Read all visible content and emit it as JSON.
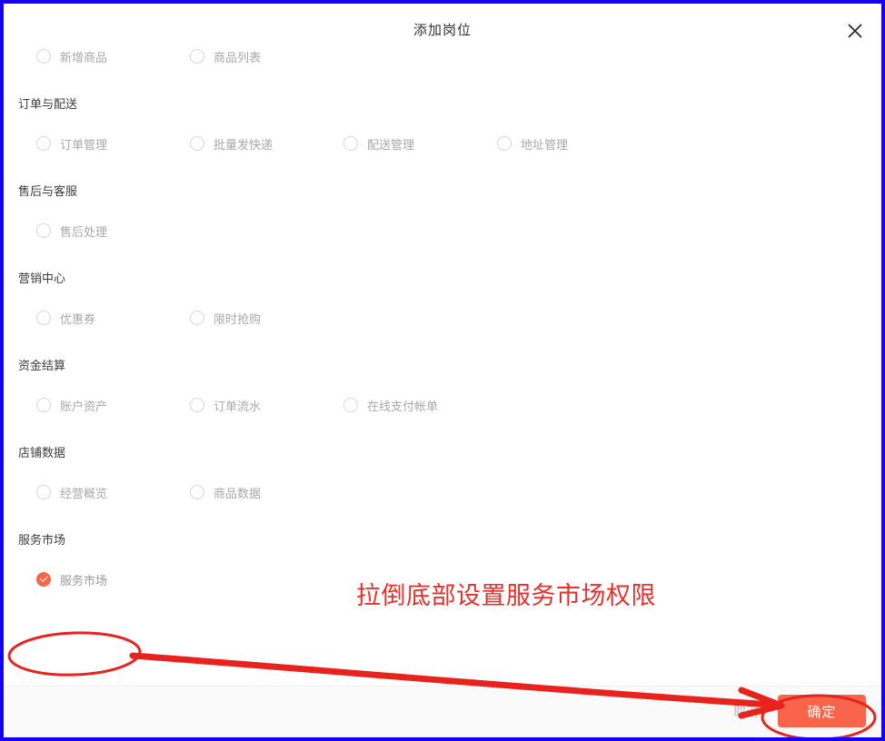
{
  "dialog": {
    "title": "添加岗位",
    "close_icon": "close-icon"
  },
  "groups": [
    {
      "title": "",
      "items": [
        {
          "label": "新增商品",
          "checked": false
        },
        {
          "label": "商品列表",
          "checked": false
        }
      ]
    },
    {
      "title": "订单与配送",
      "items": [
        {
          "label": "订单管理",
          "checked": false
        },
        {
          "label": "批量发快递",
          "checked": false
        },
        {
          "label": "配送管理",
          "checked": false
        },
        {
          "label": "地址管理",
          "checked": false
        }
      ]
    },
    {
      "title": "售后与客服",
      "items": [
        {
          "label": "售后处理",
          "checked": false
        }
      ]
    },
    {
      "title": "营销中心",
      "items": [
        {
          "label": "优惠券",
          "checked": false
        },
        {
          "label": "限时抢购",
          "checked": false
        }
      ]
    },
    {
      "title": "资金结算",
      "items": [
        {
          "label": "账户资产",
          "checked": false
        },
        {
          "label": "订单流水",
          "checked": false
        },
        {
          "label": "在线支付帐单",
          "checked": false
        }
      ]
    },
    {
      "title": "店铺数据",
      "items": [
        {
          "label": "经营概览",
          "checked": false
        },
        {
          "label": "商品数据",
          "checked": false
        }
      ]
    },
    {
      "title": "服务市场",
      "items": [
        {
          "label": "服务市场",
          "checked": true
        }
      ]
    }
  ],
  "footer": {
    "cancel_label": "取消",
    "confirm_label": "确定"
  },
  "annotation": {
    "text": "拉倒底部设置服务市场权限",
    "color": "#e8302b",
    "shapes": [
      "ellipse-around-service-market-item",
      "ellipse-around-confirm-button",
      "arrow-to-confirm-button"
    ]
  },
  "colors": {
    "accent": "#f8654a",
    "annotation_red": "#e8302b",
    "selection_frame_blue": "#1300f5",
    "footer_background": "#fafafa",
    "label_gray": "#a8a8a8",
    "title_dark": "#333333"
  }
}
